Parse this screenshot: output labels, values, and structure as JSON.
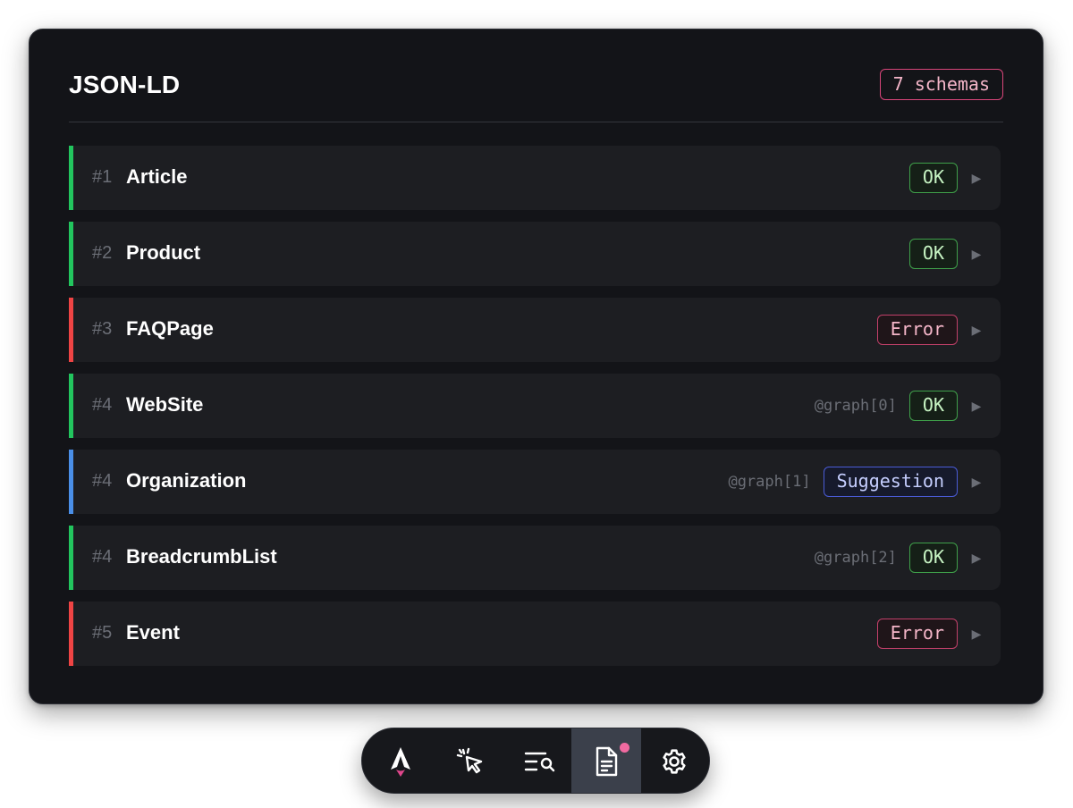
{
  "panel": {
    "title": "JSON-LD",
    "count_label": "7 schemas"
  },
  "schemas": [
    {
      "index": "#1",
      "name": "Article",
      "path": "",
      "status": "OK",
      "status_kind": "ok",
      "bar_color": "#22c55e"
    },
    {
      "index": "#2",
      "name": "Product",
      "path": "",
      "status": "OK",
      "status_kind": "ok",
      "bar_color": "#22c55e"
    },
    {
      "index": "#3",
      "name": "FAQPage",
      "path": "",
      "status": "Error",
      "status_kind": "error",
      "bar_color": "#ef4444"
    },
    {
      "index": "#4",
      "name": "WebSite",
      "path": "@graph[0]",
      "status": "OK",
      "status_kind": "ok",
      "bar_color": "#22c55e"
    },
    {
      "index": "#4",
      "name": "Organization",
      "path": "@graph[1]",
      "status": "Suggestion",
      "status_kind": "suggestion",
      "bar_color": "#4a8fe8"
    },
    {
      "index": "#4",
      "name": "BreadcrumbList",
      "path": "@graph[2]",
      "status": "OK",
      "status_kind": "ok",
      "bar_color": "#22c55e"
    },
    {
      "index": "#5",
      "name": "Event",
      "path": "",
      "status": "Error",
      "status_kind": "error",
      "bar_color": "#ef4444"
    }
  ],
  "toolbar": {
    "items": [
      {
        "icon": "astro-logo-icon",
        "active": false
      },
      {
        "icon": "pointer-click-icon",
        "active": false
      },
      {
        "icon": "list-search-icon",
        "active": false
      },
      {
        "icon": "document-icon",
        "active": true,
        "has_notification": true
      },
      {
        "icon": "gear-icon",
        "active": false
      }
    ]
  },
  "colors": {
    "ok": "#22c55e",
    "error": "#ef4444",
    "suggestion": "#4a8fe8",
    "notification": "#f06aa0"
  }
}
